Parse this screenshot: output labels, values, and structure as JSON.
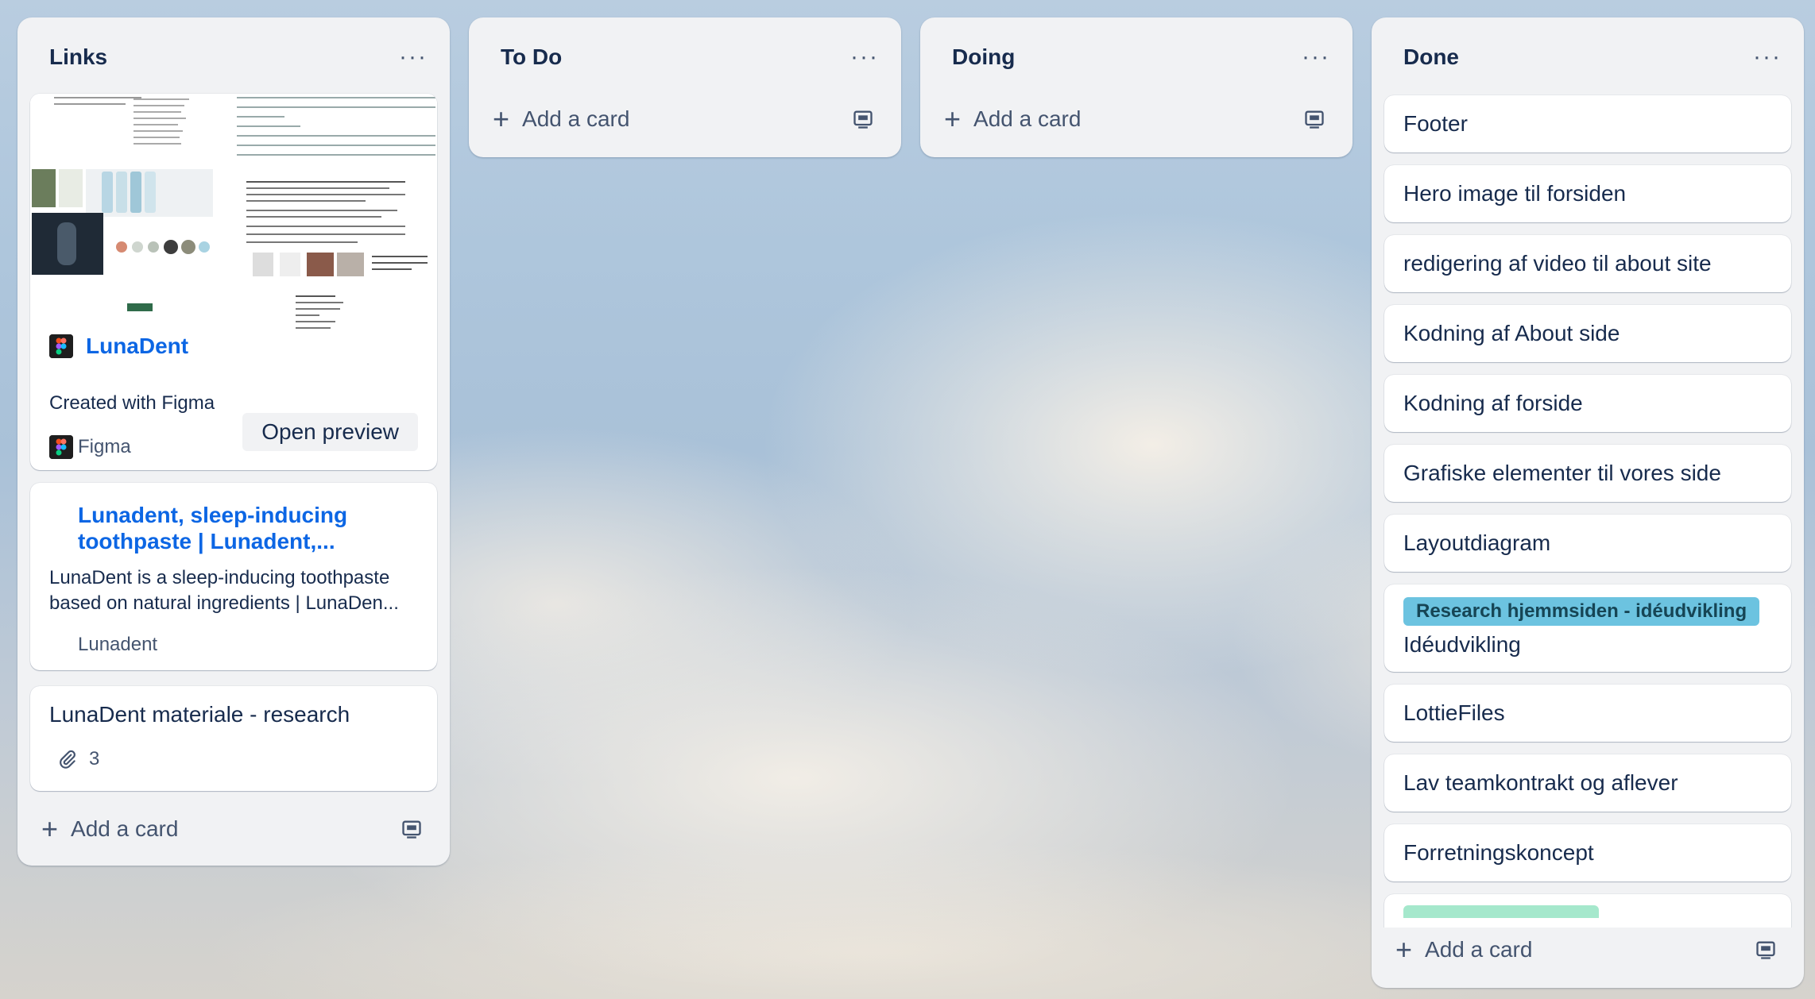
{
  "lists": [
    {
      "title": "Links",
      "cards": {
        "figma": {
          "title": "LunaDent",
          "subtitle": "Created with Figma",
          "source": "Figma",
          "button": "Open preview"
        },
        "link": {
          "title": "Lunadent, sleep-inducing toothpaste | Lunadent,...",
          "description": "LunaDent is a sleep-inducing toothpaste based on natural ingredients | LunaDen...",
          "domain": "Lunadent"
        },
        "research": {
          "title": "LunaDent materiale - research",
          "attachments": "3"
        }
      },
      "add_card": "Add a card"
    },
    {
      "title": "To Do",
      "add_card": "Add a card"
    },
    {
      "title": "Doing",
      "add_card": "Add a card"
    },
    {
      "title": "Done",
      "cards": [
        "Footer",
        "Hero image til forsiden",
        "redigering af video til about site",
        "Kodning af About side",
        "Kodning af forside",
        "Grafiske elementer til vores side",
        "Layoutdiagram"
      ],
      "labeled_card": {
        "label": "Research hjemmsiden - idéudvikling",
        "title": "Idéudvikling"
      },
      "cards_after": [
        "LottieFiles",
        "Lav teamkontrakt og aflever",
        "Forretningskoncept"
      ],
      "add_card": "Add a card"
    }
  ],
  "colors": {
    "list_bg": "#f1f2f4",
    "link_blue": "#0c66e4",
    "label_blue": "#6cc3e0",
    "label_green": "#4bce97"
  }
}
